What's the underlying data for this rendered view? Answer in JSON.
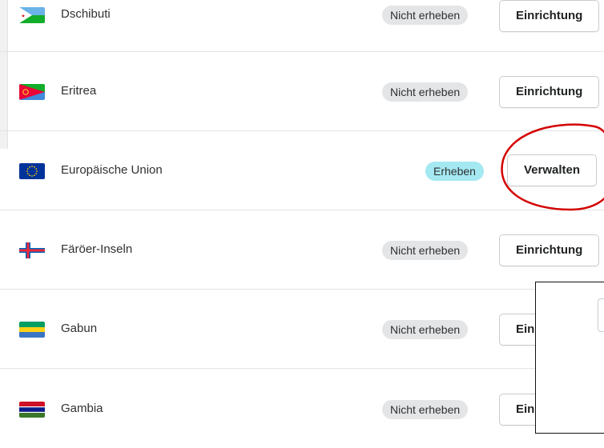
{
  "countries": [
    {
      "name": "Dschibuti",
      "status": "Nicht erheben",
      "action": "Einrichtung",
      "flag_icon": "djibouti-flag-icon"
    },
    {
      "name": "Eritrea",
      "status": "Nicht erheben",
      "action": "Einrichtung",
      "flag_icon": "eritrea-flag-icon"
    },
    {
      "name": "Europäische Union",
      "status": "Erheben",
      "action": "Verwalten",
      "flag_icon": "eu-flag-icon"
    },
    {
      "name": "Färöer-Inseln",
      "status": "Nicht erheben",
      "action": "Einrichtung",
      "flag_icon": "faroe-islands-flag-icon"
    },
    {
      "name": "Gabun",
      "status": "Nicht erheben",
      "action": "Ein",
      "flag_icon": "gabon-flag-icon"
    },
    {
      "name": "Gambia",
      "status": "Nicht erheben",
      "action": "Ein",
      "flag_icon": "gambia-flag-icon"
    }
  ],
  "colors": {
    "badge_inactive": "#e4e5e7",
    "badge_active": "#a4e8f2",
    "annotation_circle": "#d40000",
    "divider": "#e3e3e3"
  }
}
